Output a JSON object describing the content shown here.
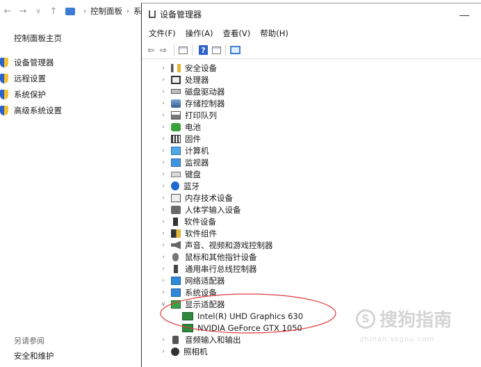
{
  "background_window": {
    "nav": {
      "back_glyph": "←",
      "forward_glyph": "→",
      "down_glyph": "∨",
      "up_glyph": "↑"
    },
    "breadcrumb": [
      {
        "label": "控制面板"
      },
      {
        "label": "系"
      }
    ],
    "sidebar": {
      "home_label": "控制面板主页",
      "links": [
        {
          "label": "设备管理器",
          "icon": "shield-icon"
        },
        {
          "label": "远程设置",
          "icon": "shield-icon"
        },
        {
          "label": "系统保护",
          "icon": "shield-icon"
        },
        {
          "label": "高级系统设置",
          "icon": "shield-icon"
        }
      ],
      "see_also_label": "另请参阅",
      "security_link": "安全和维护"
    }
  },
  "device_manager": {
    "title": "设备管理器",
    "menu": [
      "文件(F)",
      "操作(A)",
      "查看(V)",
      "帮助(H)"
    ],
    "toolbar": {
      "back_glyph": "⇦",
      "forward_glyph": "⇨",
      "help_glyph": "?"
    },
    "tree": [
      {
        "label": "安全设备",
        "icon": "key-icon",
        "expanded": false
      },
      {
        "label": "处理器",
        "icon": "cpu-icon",
        "expanded": false
      },
      {
        "label": "磁盘驱动器",
        "icon": "disk-icon",
        "expanded": false
      },
      {
        "label": "存储控制器",
        "icon": "storage-icon",
        "expanded": false
      },
      {
        "label": "打印队列",
        "icon": "printer-icon",
        "expanded": false
      },
      {
        "label": "电池",
        "icon": "battery-icon",
        "expanded": false
      },
      {
        "label": "固件",
        "icon": "firmware-icon",
        "expanded": false
      },
      {
        "label": "计算机",
        "icon": "computer-icon",
        "expanded": false
      },
      {
        "label": "监视器",
        "icon": "monitor-icon",
        "expanded": false
      },
      {
        "label": "键盘",
        "icon": "keyboard-icon",
        "expanded": false
      },
      {
        "label": "蓝牙",
        "icon": "bluetooth-icon",
        "expanded": false
      },
      {
        "label": "内存技术设备",
        "icon": "memory-icon",
        "expanded": false
      },
      {
        "label": "人体学输入设备",
        "icon": "hid-icon",
        "expanded": false
      },
      {
        "label": "软件设备",
        "icon": "software-icon",
        "expanded": false
      },
      {
        "label": "软件组件",
        "icon": "component-icon",
        "expanded": false
      },
      {
        "label": "声音、视频和游戏控制器",
        "icon": "audio-icon",
        "expanded": false
      },
      {
        "label": "鼠标和其他指针设备",
        "icon": "mouse-icon",
        "expanded": false
      },
      {
        "label": "通用串行总线控制器",
        "icon": "usb-icon",
        "expanded": false
      },
      {
        "label": "网络适配器",
        "icon": "network-icon",
        "expanded": false
      },
      {
        "label": "系统设备",
        "icon": "system-icon",
        "expanded": false
      },
      {
        "label": "显示适配器",
        "icon": "display-adapter-icon",
        "expanded": true,
        "children": [
          {
            "label": "Intel(R) UHD Graphics 630",
            "icon": "gpu-icon"
          },
          {
            "label": "NVIDIA GeForce GTX 1050",
            "icon": "gpu-icon"
          }
        ]
      },
      {
        "label": "音频输入和输出",
        "icon": "audio-io-icon",
        "expanded": false
      },
      {
        "label": "照相机",
        "icon": "camera-icon",
        "expanded": false
      }
    ],
    "expander_collapsed": "›",
    "expander_expanded": "∨"
  },
  "annotation": {
    "color": "#e0393b"
  },
  "watermark": {
    "text": "搜狗指南",
    "logo_glyph": "S",
    "url": "zhinan.sogou.com"
  },
  "colors": {
    "accent": "#2d63c8",
    "display_adapter": "#3aa049"
  }
}
